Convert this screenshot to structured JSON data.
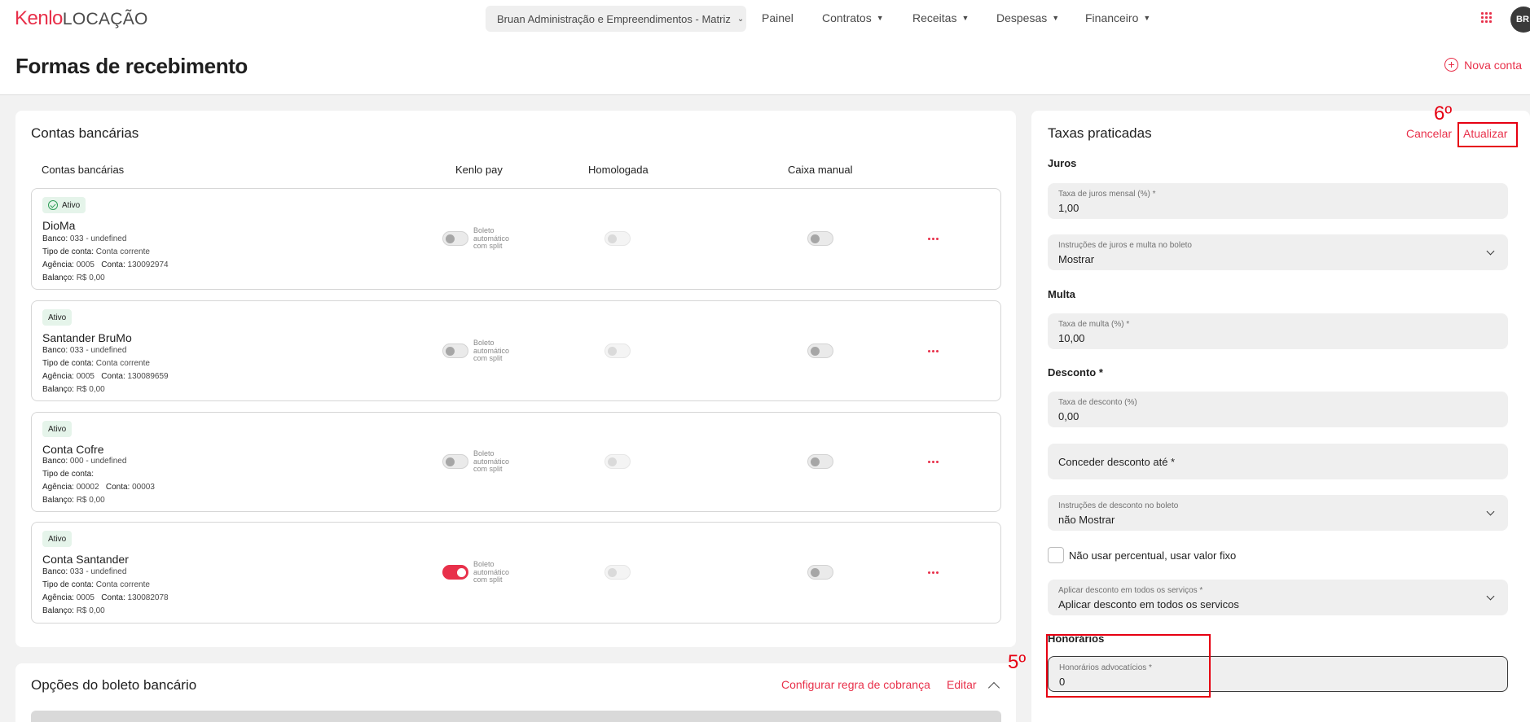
{
  "nav": {
    "brand": "Kenlo",
    "product": "LOCAÇÃO",
    "org": "Bruan Administração e Empreendimentos - Matriz",
    "items": [
      "Painel",
      "Contratos",
      "Receitas",
      "Despesas",
      "Financeiro"
    ],
    "avatar": "BR"
  },
  "header": {
    "title": "Formas de recebimento",
    "new_account": "Nova conta"
  },
  "accounts_card": {
    "title": "Contas bancárias",
    "columns": [
      "Contas bancárias",
      "Kenlo pay",
      "Homologada",
      "Caixa manual"
    ],
    "kenlo_pay_label": [
      "Boleto",
      "automático",
      "com split"
    ],
    "items": [
      {
        "status": "Ativo",
        "name": "DioMa",
        "bank_label": "Banco:",
        "bank": "033 - undefined",
        "type_label": "Tipo de conta:",
        "type": "Conta corrente",
        "agency_label": "Agência:",
        "agency": "0005",
        "account_label": "Conta:",
        "account": "130092974",
        "balance_label": "Balanço:",
        "balance": "R$ 0,00",
        "kenlo_pay": false
      },
      {
        "status": "Ativo",
        "name": "Santander BruMo",
        "bank_label": "Banco:",
        "bank": "033 - undefined",
        "type_label": "Tipo de conta:",
        "type": "Conta corrente",
        "agency_label": "Agência:",
        "agency": "0005",
        "account_label": "Conta:",
        "account": "130089659",
        "balance_label": "Balanço:",
        "balance": "R$ 0,00",
        "kenlo_pay": false
      },
      {
        "status": "Ativo",
        "name": "Conta Cofre",
        "bank_label": "Banco:",
        "bank": "000 - undefined",
        "type_label": "Tipo de conta:",
        "type": "",
        "agency_label": "Agência:",
        "agency": "00002",
        "account_label": "Conta:",
        "account": "00003",
        "balance_label": "Balanço:",
        "balance": "R$ 0,00",
        "kenlo_pay": false
      },
      {
        "status": "Ativo",
        "name": "Conta Santander",
        "bank_label": "Banco:",
        "bank": "033 - undefined",
        "type_label": "Tipo de conta:",
        "type": "Conta corrente",
        "agency_label": "Agência:",
        "agency": "0005",
        "account_label": "Conta:",
        "account": "130082078",
        "balance_label": "Balanço:",
        "balance": "R$ 0,00",
        "kenlo_pay": true
      }
    ]
  },
  "boleto_card": {
    "title": "Opções do boleto bancário",
    "configure": "Configurar regra de cobrança",
    "edit": "Editar"
  },
  "rates": {
    "title": "Taxas praticadas",
    "cancel": "Cancelar",
    "update": "Atualizar",
    "juros_section": "Juros",
    "juros_label": "Taxa de juros mensal (%) *",
    "juros_value": "1,00",
    "juros_instr_label": "Instruções de juros e multa no boleto",
    "juros_instr_value": "Mostrar",
    "multa_section": "Multa",
    "multa_label": "Taxa de multa (%) *",
    "multa_value": "10,00",
    "desconto_section": "Desconto *",
    "desconto_label": "Taxa de desconto (%)",
    "desconto_value": "0,00",
    "conceder_label": "Conceder desconto até *",
    "desc_instr_label": "Instruções de desconto no boleto",
    "desc_instr_value": "não Mostrar",
    "fixed_value_label": "Não usar percentual, usar valor fixo",
    "apply_label": "Aplicar desconto em todos os serviços *",
    "apply_value": "Aplicar desconto em todos os servicos",
    "honorarios_section": "Honorários",
    "honorarios_label": "Honorários advocatícios *",
    "honorarios_value": "0"
  },
  "annotations": {
    "step5": "5º",
    "step6": "6º"
  }
}
